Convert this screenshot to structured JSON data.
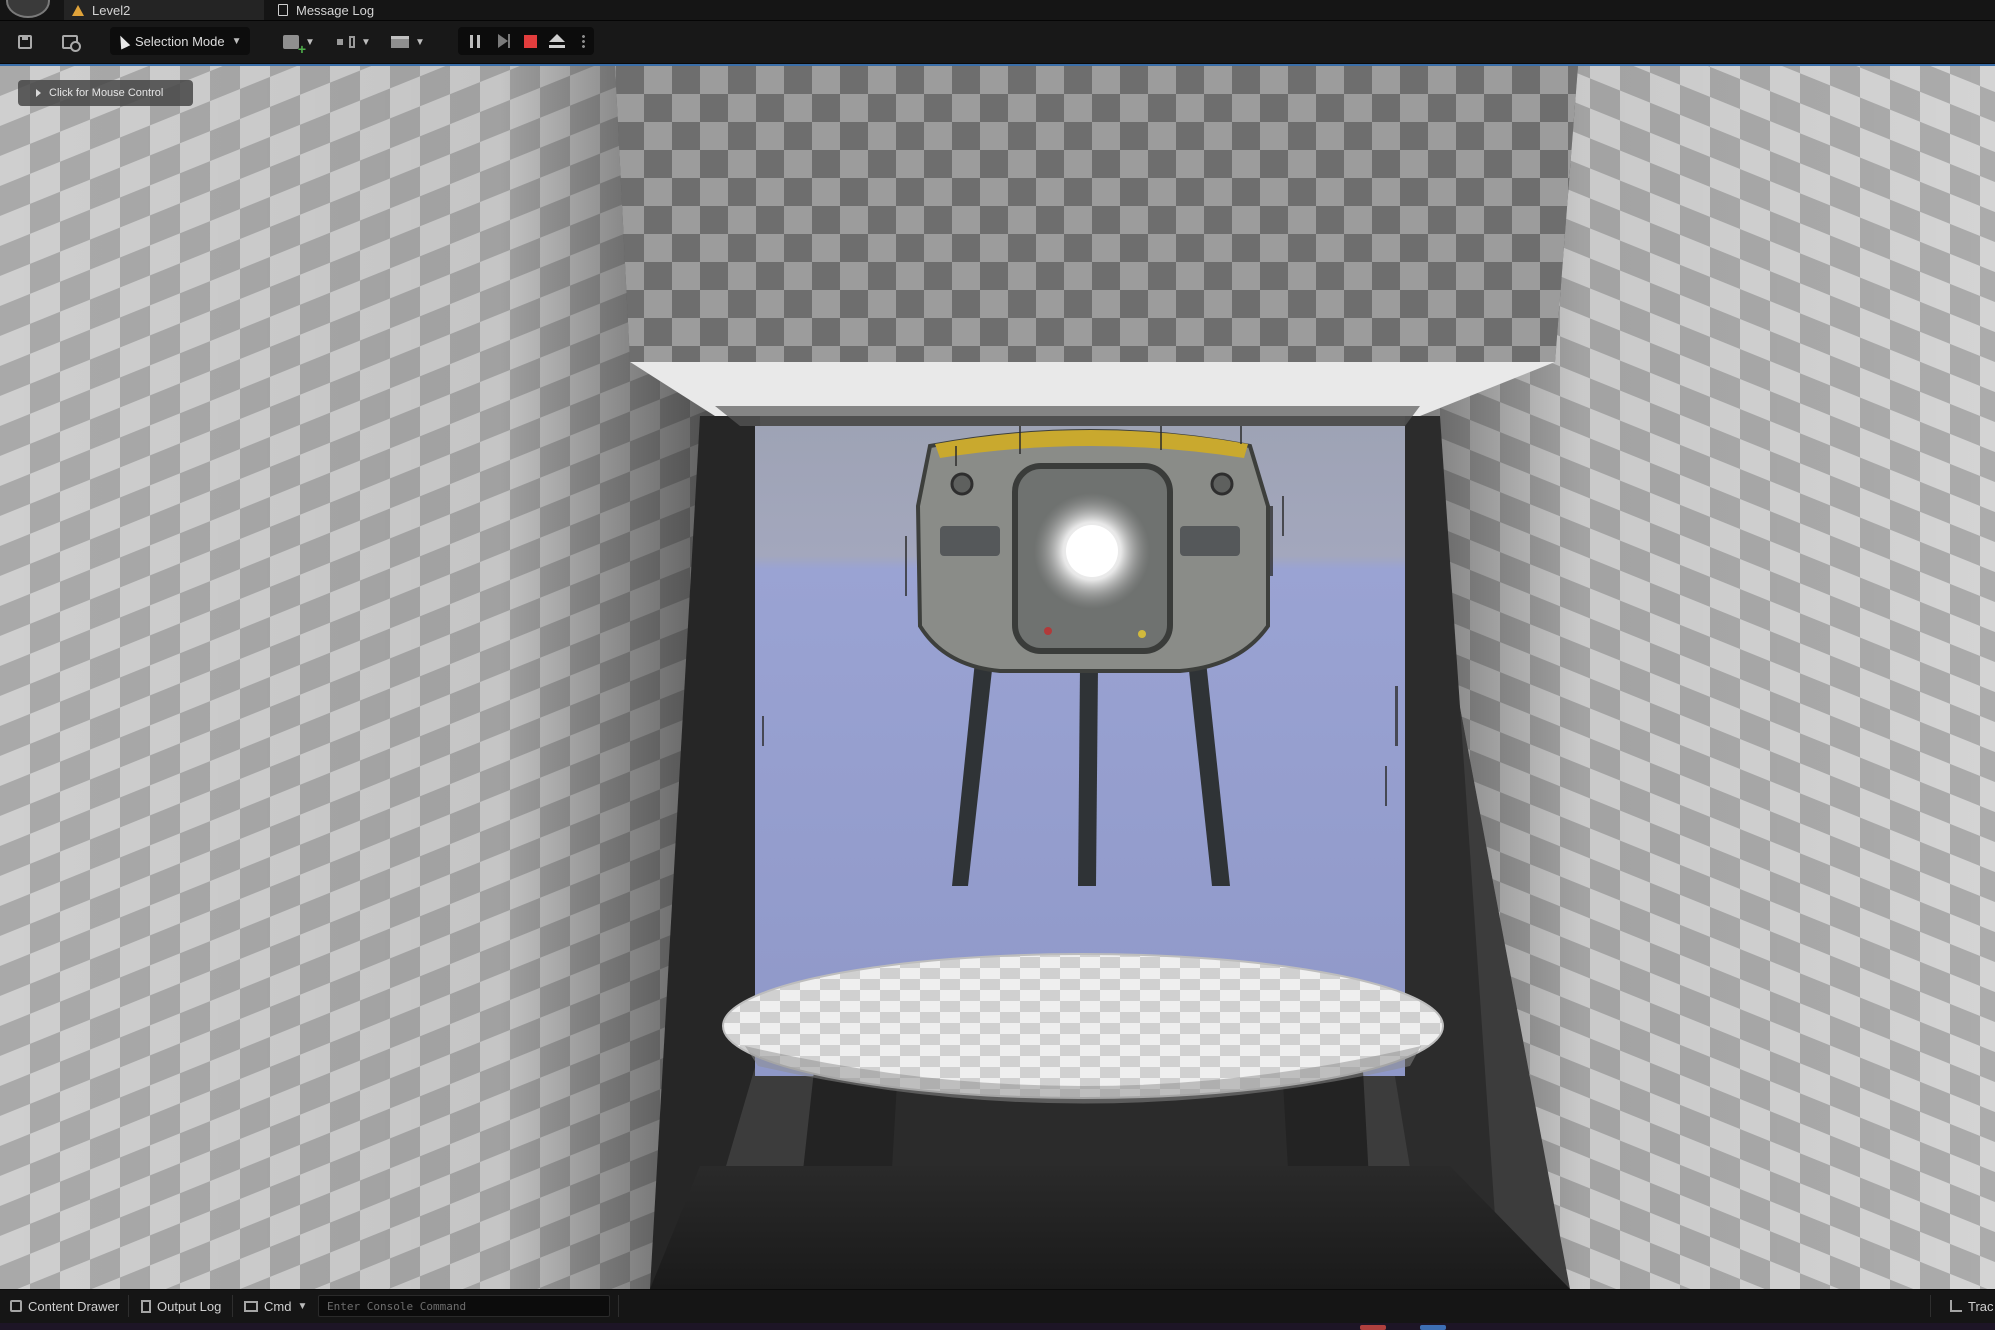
{
  "tabs": {
    "level": {
      "label": "Level2",
      "icon": "warning-icon"
    },
    "message_log": {
      "label": "Message Log",
      "icon": "document-icon"
    }
  },
  "toolbar": {
    "selection_mode_label": "Selection Mode",
    "playback": {
      "pause": "pause-icon",
      "step": "step-icon",
      "stop": "stop-icon",
      "eject": "eject-icon"
    },
    "stop_color": "#e23d3d"
  },
  "viewport": {
    "mouse_hint": "Click for Mouse Control"
  },
  "statusbar": {
    "content_drawer": "Content Drawer",
    "output_log": "Output Log",
    "cmd": "Cmd",
    "console_placeholder": "Enter Console Command",
    "trace": "Trac"
  },
  "colors": {
    "background": "#0f0f0f",
    "toolbar": "#181818",
    "accent_warning": "#e0a33a",
    "viewport_border": "#3a6ea8"
  }
}
